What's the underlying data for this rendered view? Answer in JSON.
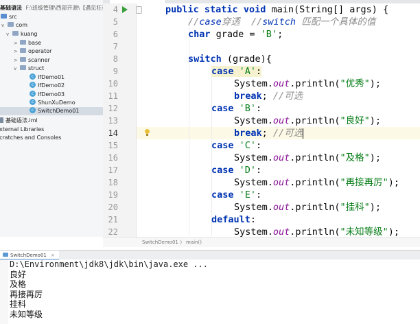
{
  "project_tree": {
    "root_label": "基础语法",
    "root_path": "F:\\班级管理\\西部开源\\【遇见狂神说】\\JavaSE\\基础",
    "items": [
      {
        "label": "src",
        "kind": "source-folder"
      },
      {
        "label": "com",
        "kind": "package"
      },
      {
        "label": "kuang",
        "kind": "package"
      },
      {
        "label": "base",
        "kind": "package"
      },
      {
        "label": "operator",
        "kind": "package"
      },
      {
        "label": "scanner",
        "kind": "package"
      },
      {
        "label": "struct",
        "kind": "package"
      },
      {
        "label": "IfDemo01",
        "kind": "class"
      },
      {
        "label": "IfDemo02",
        "kind": "class"
      },
      {
        "label": "IfDemo03",
        "kind": "class"
      },
      {
        "label": "ShunXuDemo",
        "kind": "class"
      },
      {
        "label": "SwitchDemo01",
        "kind": "class",
        "selected": true
      },
      {
        "label": "基础语法.iml",
        "kind": "module-file"
      },
      {
        "label": "External Libraries",
        "kind": "libraries"
      },
      {
        "label": "Scratches and Consoles",
        "kind": "scratches"
      }
    ]
  },
  "editor": {
    "line_numbers": [
      "4",
      "5",
      "6",
      "7",
      "8",
      "9",
      "10",
      "11",
      "12",
      "13",
      "14",
      "15",
      "16",
      "17",
      "18",
      "19",
      "20",
      "21",
      "22"
    ],
    "current_line": "14",
    "tokens": {
      "public": "public",
      "static": "static",
      "void": "void",
      "main_sig": " main(String[] args) {",
      "case": "case",
      "switch": "switch",
      "break": "break",
      "default": "default",
      "char": "char",
      "case_penetration_comment": "穿透  //",
      "switch_comment_tail": " 匹配一个具体的值",
      "comment_prefix": "//",
      "grade_decl": " grade = ",
      "semicolon": ";",
      "switch_paren": " (grade){",
      "sysout_prefix": "System.",
      "out": "out",
      "println_open": ".println(",
      "println_close": ");",
      "optional_comment": "//可选",
      "colon": ":",
      "space": " "
    },
    "strings": {
      "B_literal": "'B'",
      "A_case": "'A'",
      "B_case": "'B'",
      "C_case": "'C'",
      "D_case": "'D'",
      "E_case": "'E'",
      "excellent": "\"优秀\"",
      "good": "\"良好\"",
      "pass": "\"及格\"",
      "retake": "\"再接再厉\"",
      "fail": "\"挂科\"",
      "unknown": "\"未知等级\""
    }
  },
  "breadcrumb": {
    "class": "SwitchDemo01",
    "separator": "〉",
    "method": "main()"
  },
  "run_panel": {
    "tab_label": "SwitchDemo01",
    "close_glyph": "×",
    "command": "D:\\Environment\\jdk8\\jdk\\bin\\java.exe ...",
    "output": [
      "良好",
      "及格",
      "再接再厉",
      "挂科",
      "未知等级"
    ]
  },
  "colors": {
    "keyword": "#0033b3",
    "string": "#067d17",
    "comment": "#8c8c8c",
    "field": "#871094",
    "run_icon": "#3a9e3a"
  }
}
